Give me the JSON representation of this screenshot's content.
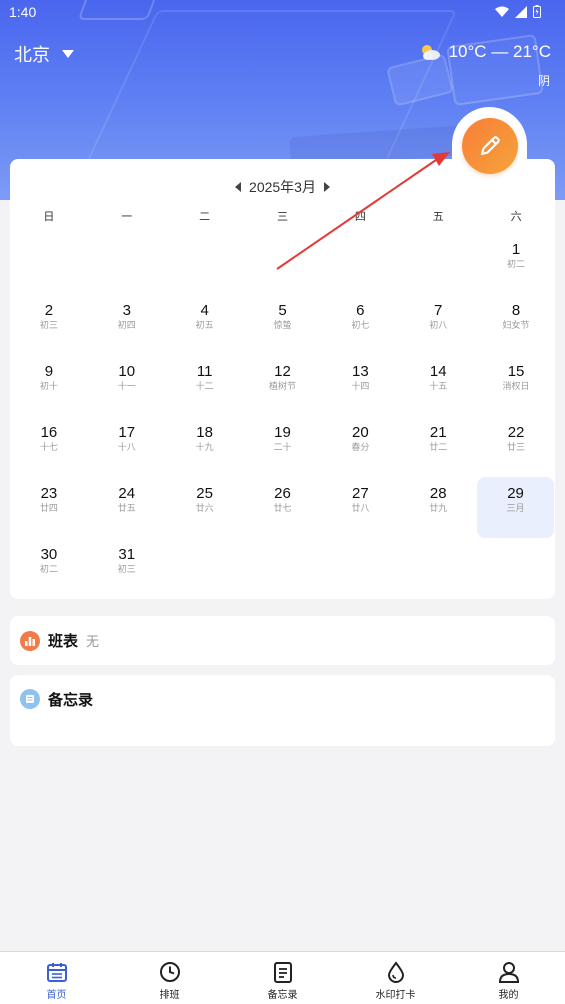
{
  "status_bar": {
    "time": "1:40"
  },
  "header": {
    "city": "北京",
    "temperature": "10°C — 21°C",
    "weather": "阴"
  },
  "calendar": {
    "month_label": "2025年3月",
    "weekdays": [
      "日",
      "一",
      "二",
      "三",
      "四",
      "五",
      "六"
    ],
    "leading_blanks": 6,
    "days": [
      {
        "day": "1",
        "lunar": "初二"
      },
      {
        "day": "2",
        "lunar": "初三"
      },
      {
        "day": "3",
        "lunar": "初四"
      },
      {
        "day": "4",
        "lunar": "初五"
      },
      {
        "day": "5",
        "lunar": "惊蛰"
      },
      {
        "day": "6",
        "lunar": "初七"
      },
      {
        "day": "7",
        "lunar": "初八"
      },
      {
        "day": "8",
        "lunar": "妇女节"
      },
      {
        "day": "9",
        "lunar": "初十"
      },
      {
        "day": "10",
        "lunar": "十一"
      },
      {
        "day": "11",
        "lunar": "十二"
      },
      {
        "day": "12",
        "lunar": "植树节"
      },
      {
        "day": "13",
        "lunar": "十四"
      },
      {
        "day": "14",
        "lunar": "十五"
      },
      {
        "day": "15",
        "lunar": "消权日"
      },
      {
        "day": "16",
        "lunar": "十七"
      },
      {
        "day": "17",
        "lunar": "十八"
      },
      {
        "day": "18",
        "lunar": "十九"
      },
      {
        "day": "19",
        "lunar": "二十"
      },
      {
        "day": "20",
        "lunar": "春分"
      },
      {
        "day": "21",
        "lunar": "廿二"
      },
      {
        "day": "22",
        "lunar": "廿三"
      },
      {
        "day": "23",
        "lunar": "廿四"
      },
      {
        "day": "24",
        "lunar": "廿五"
      },
      {
        "day": "25",
        "lunar": "廿六"
      },
      {
        "day": "26",
        "lunar": "廿七"
      },
      {
        "day": "27",
        "lunar": "廿八"
      },
      {
        "day": "28",
        "lunar": "廿九"
      },
      {
        "day": "29",
        "lunar": "三月",
        "selected": true
      },
      {
        "day": "30",
        "lunar": "初二"
      },
      {
        "day": "31",
        "lunar": "初三"
      }
    ]
  },
  "schedule": {
    "title": "班表",
    "value": "无",
    "icon": "bar-chart-icon",
    "color": "#f07c4a"
  },
  "memo": {
    "title": "备忘录",
    "icon": "note-icon",
    "color": "#8fc3ee"
  },
  "tabs": [
    {
      "label": "首页",
      "icon": "calendar-icon",
      "active": true
    },
    {
      "label": "排班",
      "icon": "clock-icon",
      "active": false
    },
    {
      "label": "备忘录",
      "icon": "document-icon",
      "active": false
    },
    {
      "label": "水印打卡",
      "icon": "drop-icon",
      "active": false
    },
    {
      "label": "我的",
      "icon": "person-icon",
      "active": false
    }
  ],
  "colors": {
    "accent": "#3a5fd9",
    "edit_button": "#f68c38",
    "annotation_arrow": "#e53935"
  }
}
